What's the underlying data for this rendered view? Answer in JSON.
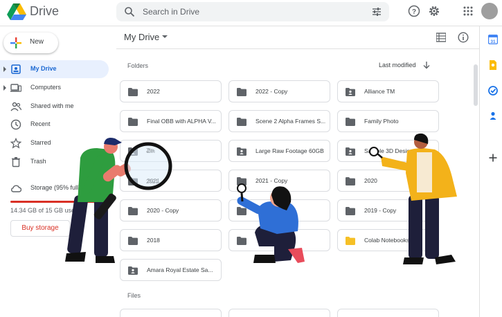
{
  "app": {
    "title": "Drive"
  },
  "search": {
    "placeholder": "Search in Drive"
  },
  "toolbar": {
    "icons": [
      "search-icon",
      "tune-icon",
      "help-icon",
      "settings-icon",
      "apps-icon",
      "avatar"
    ]
  },
  "sidebar": {
    "new_label": "New",
    "items": [
      {
        "label": "My Drive",
        "icon": "my-drive-icon",
        "active": true
      },
      {
        "label": "Computers",
        "icon": "computers-icon"
      },
      {
        "label": "Shared with me",
        "icon": "shared-icon"
      },
      {
        "label": "Recent",
        "icon": "clock-icon"
      },
      {
        "label": "Starred",
        "icon": "star-icon"
      },
      {
        "label": "Trash",
        "icon": "trash-icon"
      }
    ],
    "storage": {
      "label": "Storage (95% full)",
      "used_fraction": 0.95,
      "usage_text": "14.34 GB of 15 GB used",
      "buy_label": "Buy storage"
    }
  },
  "main": {
    "breadcrumb": "My Drive",
    "folders_label": "Folders",
    "sort_label": "Last modified",
    "files_label": "Files",
    "folders": [
      {
        "name": "2022",
        "type": "folder"
      },
      {
        "name": "2022 - Copy",
        "type": "folder"
      },
      {
        "name": "Alliance TM",
        "type": "shared"
      },
      {
        "name": "Final OBB with ALPHA V...",
        "type": "folder"
      },
      {
        "name": "Scene 2 Alpha Frames S...",
        "type": "folder"
      },
      {
        "name": "Family Photo",
        "type": "folder"
      },
      {
        "name": "Zin",
        "type": "shared"
      },
      {
        "name": "Large Raw Footage 60GB",
        "type": "shared"
      },
      {
        "name": "Sample 3D Design",
        "type": "shared"
      },
      {
        "name": "2021",
        "type": "folder"
      },
      {
        "name": "2021 - Copy",
        "type": "folder"
      },
      {
        "name": "2020",
        "type": "folder"
      },
      {
        "name": "2020 - Copy",
        "type": "folder"
      },
      {
        "name": "",
        "type": "folder"
      },
      {
        "name": "2019 - Copy",
        "type": "folder"
      },
      {
        "name": "2018",
        "type": "folder"
      },
      {
        "name": "",
        "type": "folder"
      },
      {
        "name": "Colab Notebooks",
        "type": "folder-yellow"
      },
      {
        "name": "Amara Royal Estate Sa...",
        "type": "shared"
      }
    ]
  },
  "colors": {
    "accent": "#1967d2",
    "active_bg": "#e8f0fe",
    "danger": "#d93025",
    "folder": "#5f6368",
    "folder_yellow": "#f6c026"
  }
}
